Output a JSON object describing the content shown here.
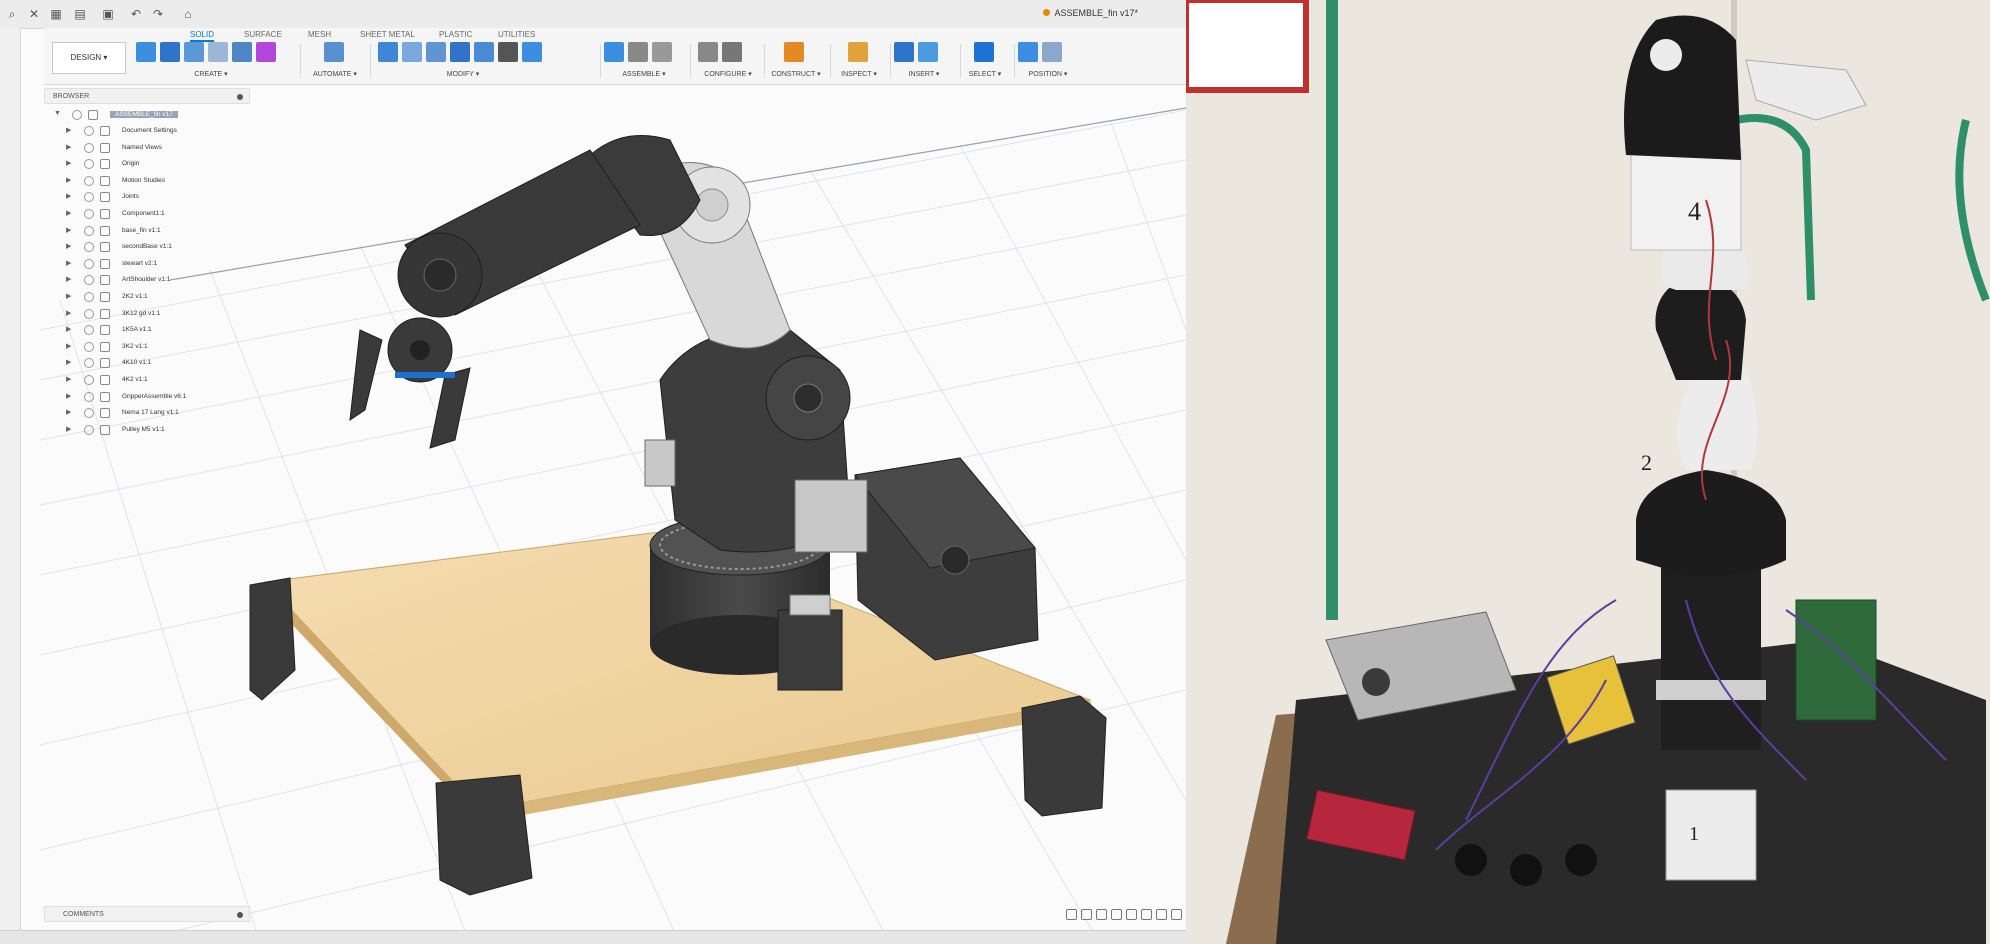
{
  "window": {
    "document_title": "ASSEMBLE_fin v17*"
  },
  "ribbon": {
    "mode_button": "DESIGN ▾",
    "tabs": [
      {
        "label": "SOLID",
        "active": true
      },
      {
        "label": "SURFACE",
        "active": false
      },
      {
        "label": "MESH",
        "active": false
      },
      {
        "label": "SHEET METAL",
        "active": false
      },
      {
        "label": "PLASTIC",
        "active": false
      },
      {
        "label": "UTILITIES",
        "active": false
      }
    ],
    "groups": [
      {
        "label": "CREATE ▾",
        "icons": [
          "new-component-icon",
          "extrude-icon",
          "revolve-icon",
          "hole-icon",
          "sketch-icon",
          "form-icon"
        ]
      },
      {
        "label": "AUTOMATE ▾",
        "icons": [
          "automate-icon"
        ]
      },
      {
        "label": "MODIFY ▾",
        "icons": [
          "press-pull-icon",
          "fillet-icon",
          "chamfer-icon",
          "shell-icon",
          "combine-icon",
          "move-icon",
          "align-icon"
        ]
      },
      {
        "label": "ASSEMBLE ▾",
        "icons": [
          "new-component-icon",
          "joint-icon",
          "as-built-joint-icon"
        ]
      },
      {
        "label": "CONFIGURE ▾",
        "icons": [
          "configure-icon",
          "table-icon"
        ]
      },
      {
        "label": "CONSTRUCT ▾",
        "icons": [
          "plane-icon"
        ]
      },
      {
        "label": "INSPECT ▾",
        "icons": [
          "measure-icon"
        ]
      },
      {
        "label": "INSERT ▾",
        "icons": [
          "insert-icon",
          "canvas-icon"
        ]
      },
      {
        "label": "SELECT ▾",
        "icons": [
          "select-icon"
        ]
      },
      {
        "label": "POSITION ▾",
        "icons": [
          "capture-icon",
          "revert-icon"
        ]
      }
    ]
  },
  "browser": {
    "header": "BROWSER",
    "root": "ASSEMBLE_fin v17",
    "items": [
      "Document Settings",
      "Named Views",
      "Origin",
      "Motion Studies",
      "Joints",
      "Component1:1",
      "base_fin v1:1",
      "secondBase v1:1",
      "stewart v2:1",
      "ArtShoulder v1:1",
      "2K2 v1:1",
      "3K12 gd v1:1",
      "1K5A v1:1",
      "3K2 v1:1",
      "4K10 v1:1",
      "4K2 v1:1",
      "GripperAssemble v6:1",
      "Nema 17 Lang v1:1",
      "Pulley M5 v1:1"
    ]
  },
  "comments": {
    "label": "COMMENTS"
  },
  "photo": {
    "labels": [
      "4",
      "2",
      "1"
    ]
  },
  "colors": {
    "accent": "#0a7ad1",
    "robot_dark": "#3c3c3c",
    "robot_light": "#d9d9d9",
    "baseplate": "#f2d8a6",
    "wall": "#ece6dd",
    "pipe": "#2e8f6a"
  }
}
